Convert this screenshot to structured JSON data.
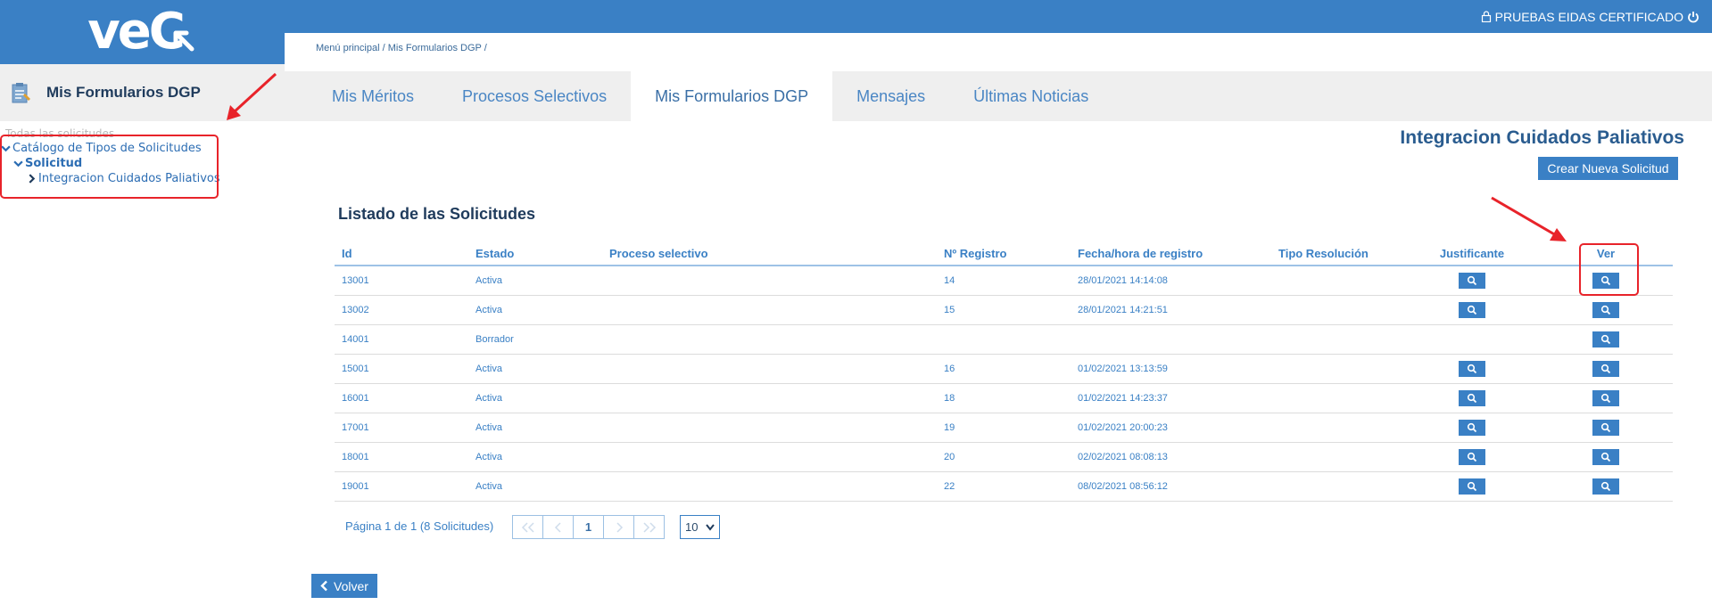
{
  "logo": {
    "text": "veC"
  },
  "sidebar": {
    "title": "Mis Formularios DGP",
    "tree": [
      {
        "label": "Todas las solicitudes"
      },
      {
        "label": "Catálogo de Tipos de Solicitudes"
      },
      {
        "label": "Solicitud"
      },
      {
        "label": "Integracion Cuidados Paliativos"
      }
    ]
  },
  "header": {
    "user": "PRUEBAS EIDAS CERTIFICADO"
  },
  "breadcrumb": {
    "items": [
      "Menú principal",
      "Mis Formularios DGP"
    ]
  },
  "tabs": [
    {
      "label": "Mis Méritos"
    },
    {
      "label": "Procesos Selectivos"
    },
    {
      "label": "Mis Formularios DGP"
    },
    {
      "label": "Mensajes"
    },
    {
      "label": "Últimas Noticias"
    }
  ],
  "page": {
    "title": "Integracion Cuidados Paliativos",
    "new_button": "Crear Nueva Solicitud",
    "list_title": "Listado de las Solicitudes",
    "back_button": "Volver"
  },
  "table": {
    "columns": [
      "Id",
      "Estado",
      "Proceso selectivo",
      "Nº Registro",
      "Fecha/hora de registro",
      "Tipo Resolución",
      "Justificante",
      "Ver"
    ],
    "rows": [
      {
        "id": "13001",
        "estado": "Activa",
        "proceso": "",
        "registro": "14",
        "fecha": "28/01/2021 14:14:08",
        "tipo": ""
      },
      {
        "id": "13002",
        "estado": "Activa",
        "proceso": "",
        "registro": "15",
        "fecha": "28/01/2021 14:21:51",
        "tipo": ""
      },
      {
        "id": "14001",
        "estado": "Borrador",
        "proceso": "",
        "registro": "",
        "fecha": "",
        "tipo": ""
      },
      {
        "id": "15001",
        "estado": "Activa",
        "proceso": "",
        "registro": "16",
        "fecha": "01/02/2021 13:13:59",
        "tipo": ""
      },
      {
        "id": "16001",
        "estado": "Activa",
        "proceso": "",
        "registro": "18",
        "fecha": "01/02/2021 14:23:37",
        "tipo": ""
      },
      {
        "id": "17001",
        "estado": "Activa",
        "proceso": "",
        "registro": "19",
        "fecha": "01/02/2021 20:00:23",
        "tipo": ""
      },
      {
        "id": "18001",
        "estado": "Activa",
        "proceso": "",
        "registro": "20",
        "fecha": "02/02/2021 08:08:13",
        "tipo": ""
      },
      {
        "id": "19001",
        "estado": "Activa",
        "proceso": "",
        "registro": "22",
        "fecha": "08/02/2021 08:56:12",
        "tipo": ""
      }
    ]
  },
  "pagination": {
    "info": "Página 1 de 1 (8 Solicitudes)",
    "current_page": "1",
    "page_size": "10"
  },
  "colors": {
    "primary": "#3a80c5",
    "annotation": "#e8232a",
    "tab_bar": "#efefef"
  },
  "icons": {
    "justificante": "search-icon",
    "ver": "search-icon",
    "user": "lock-icon",
    "power": "power-icon"
  }
}
